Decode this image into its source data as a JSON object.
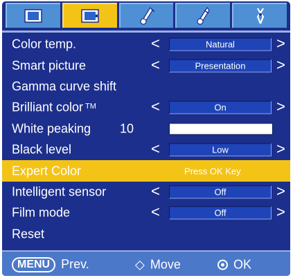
{
  "tabs": [
    {
      "icon": "picture-icon",
      "active": false
    },
    {
      "icon": "screen-icon",
      "active": true
    },
    {
      "icon": "sound-icon",
      "active": false
    },
    {
      "icon": "option-icon",
      "active": false
    },
    {
      "icon": "setup-icon",
      "active": false
    }
  ],
  "menu": {
    "color_temp": {
      "label": "Color temp.",
      "value": "Natural"
    },
    "smart_picture": {
      "label": "Smart picture",
      "value": "Presentation"
    },
    "gamma_curve_shift": {
      "label": "Gamma curve shift"
    },
    "brilliant_color": {
      "label": "Brilliant color",
      "tm": "TM",
      "value": "On"
    },
    "white_peaking": {
      "label": "White peaking",
      "value": "10",
      "level_fraction": 1.0
    },
    "black_level": {
      "label": "Black level",
      "value": "Low"
    },
    "expert_color": {
      "label": "Expert Color",
      "hint": "Press OK Key",
      "selected": true
    },
    "intelligent_sensor": {
      "label": "Intelligent sensor",
      "value": "Off"
    },
    "film_mode": {
      "label": "Film mode",
      "value": "Off"
    },
    "reset": {
      "label": "Reset"
    },
    "arrow_left": "<",
    "arrow_right": ">"
  },
  "footer": {
    "menu_key": "MENU",
    "prev_label": "Prev.",
    "move_symbol": "◇",
    "move_label": "Move",
    "ok_label": "OK"
  },
  "colors": {
    "background": "#1c2f8c",
    "tab": "#4f8fd4",
    "tab_active": "#f3c316",
    "selection": "#f3c316",
    "value_box": "#1e44b8",
    "footer": "#4c78c9"
  }
}
